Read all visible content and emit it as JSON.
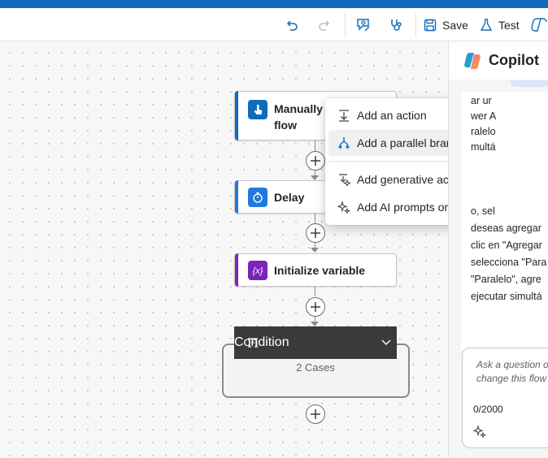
{
  "colors": {
    "brand": "#0f6cbd",
    "trigger": "#0f6cbd",
    "delay": "#1f7ae0",
    "variable": "#7b24b8",
    "condition_header": "#3b3a39"
  },
  "toolbar": {
    "undo_icon": "undo-icon",
    "redo_icon": "redo-icon",
    "flow_checker_icon": "flow-checker-icon",
    "stethoscope_icon": "stethoscope-icon",
    "save_label": "Save",
    "test_label": "Test"
  },
  "flow": {
    "steps": [
      {
        "label_line1": "Manually t",
        "label_line2": "flow",
        "icon": "hand-touch-icon"
      },
      {
        "label": "Delay",
        "icon": "timer-icon"
      },
      {
        "label": "Initialize variable",
        "icon": "variable-icon"
      }
    ],
    "condition": {
      "label": "Condition",
      "cases": "2 Cases"
    }
  },
  "menu": {
    "items": [
      {
        "label": "Add an action",
        "icon": "add-action-icon"
      },
      {
        "label": "Add a parallel branch",
        "icon": "parallel-branch-icon"
      },
      {
        "label": "Add generative action (preview)",
        "icon": "generative-action-icon"
      },
      {
        "label": "Add AI prompts or models",
        "icon": "sparkle-icon"
      }
    ]
  },
  "copilot": {
    "title": "Copilot",
    "message_lines": [
      "ar ur",
      "wer A",
      "ralelo",
      "multá",
      "",
      "o, sel",
      "deseas agregar",
      "clic en \"Agregar",
      "selecciona \"Para",
      "\"Paralelo\", agre",
      "ejecutar simultá"
    ],
    "input_placeholder_line1": "Ask a question o",
    "input_placeholder_line2": "change this flow",
    "char_count": "0/2000"
  }
}
